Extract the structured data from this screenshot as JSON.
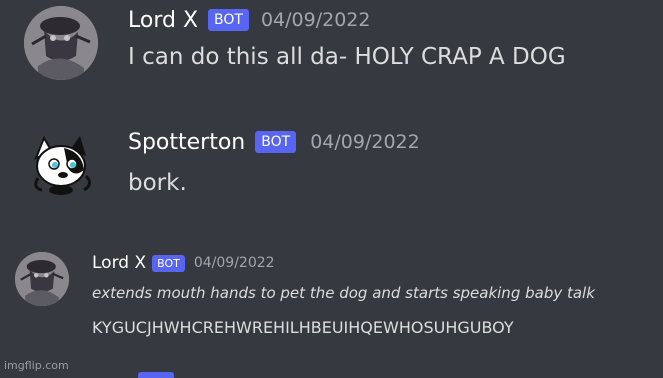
{
  "messages": [
    {
      "author": "Lord X",
      "badge": "BOT",
      "timestamp": "04/09/2022",
      "text": "I can do this all da- HOLY CRAP A DOG",
      "avatar_icon": "creature-avatar-icon"
    },
    {
      "author": "Spotterton",
      "badge": "BOT",
      "timestamp": "04/09/2022",
      "text": "bork.",
      "avatar_icon": "dog-avatar-icon"
    },
    {
      "author": "Lord X",
      "badge": "BOT",
      "timestamp": "04/09/2022",
      "action_text": "extends mouth hands to pet the dog and starts speaking baby talk",
      "text": "KYGUCJHWHCREHWREHILHBEUIHQEWHOSUHGUBOY",
      "avatar_icon": "creature-avatar-icon"
    }
  ],
  "watermark": "imgflip.com",
  "colors": {
    "background": "#36393f",
    "badge": "#5865f2",
    "username": "#ffffff",
    "timestamp": "#a3a6aa",
    "message_text": "#dcddde"
  }
}
